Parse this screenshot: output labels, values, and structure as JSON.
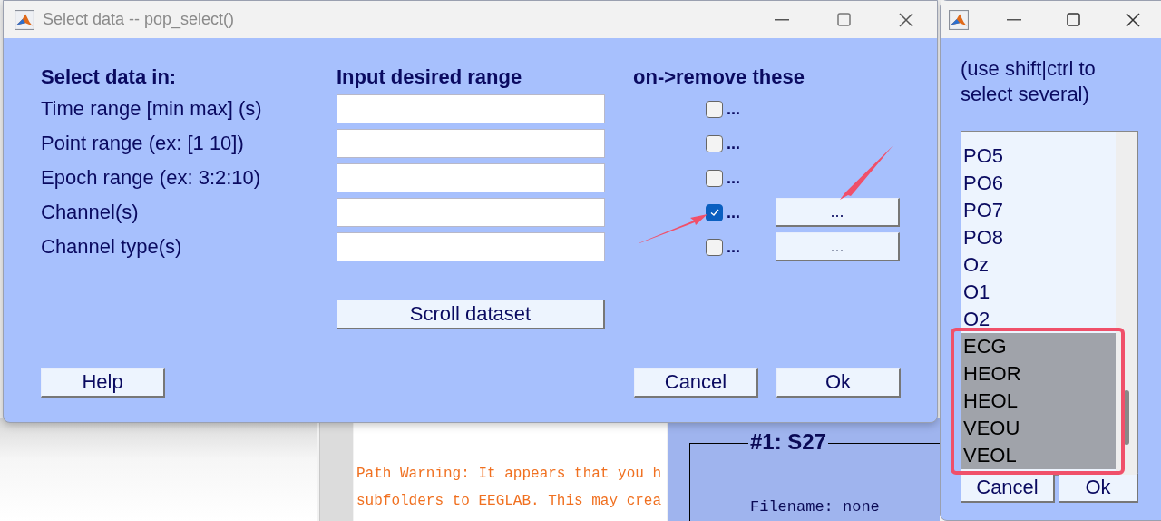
{
  "background": {
    "console_lines": [
      "Path Warning: It appears that you h",
      "subfolders to EEGLAB. This may crea"
    ],
    "panel": {
      "title": "#1: S27",
      "lines": [
        "Filename: none"
      ]
    }
  },
  "dialog": {
    "title": "Select data -- pop_select()",
    "headers": [
      "Select data in:",
      "Input desired range",
      "on->remove these"
    ],
    "rows": [
      {
        "label": "Time range [min max] (s)",
        "checked": false,
        "check_text": "..."
      },
      {
        "label": "Point range (ex: [1 10])",
        "checked": false,
        "check_text": "..."
      },
      {
        "label": "Epoch range (ex: 3:2:10)",
        "checked": false,
        "check_text": "..."
      },
      {
        "label": "Channel(s)",
        "checked": true,
        "check_text": "...",
        "button": {
          "label": "...",
          "disabled": false
        }
      },
      {
        "label": "Channel type(s)",
        "checked": false,
        "check_text": "...",
        "button": {
          "label": "...",
          "disabled": true
        }
      }
    ],
    "scroll_button": "Scroll dataset",
    "buttons": [
      "Help",
      "Cancel",
      "Ok"
    ]
  },
  "chooser": {
    "hint": "(use shift|ctrl to select several)",
    "items": [
      {
        "label": "PO5",
        "selected": false
      },
      {
        "label": "PO6",
        "selected": false
      },
      {
        "label": "PO7",
        "selected": false
      },
      {
        "label": "PO8",
        "selected": false
      },
      {
        "label": "Oz",
        "selected": false
      },
      {
        "label": "O1",
        "selected": false
      },
      {
        "label": "O2",
        "selected": false
      },
      {
        "label": "ECG",
        "selected": true
      },
      {
        "label": "HEOR",
        "selected": true
      },
      {
        "label": "HEOL",
        "selected": true
      },
      {
        "label": "VEOU",
        "selected": true
      },
      {
        "label": "VEOL",
        "selected": true
      }
    ],
    "buttons": [
      "Cancel",
      "Ok"
    ]
  }
}
